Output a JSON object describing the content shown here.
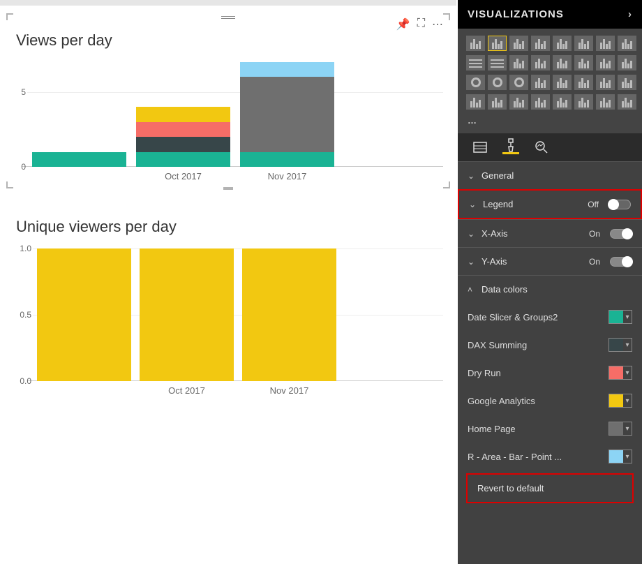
{
  "panel": {
    "title": "VISUALIZATIONS",
    "tabs_selected": "format",
    "more_icons": "…",
    "sections": {
      "general": {
        "label": "General",
        "expanded": false
      },
      "legend": {
        "label": "Legend",
        "state_label": "Off",
        "on": false,
        "expanded": false
      },
      "xaxis": {
        "label": "X-Axis",
        "state_label": "On",
        "on": true,
        "expanded": false
      },
      "yaxis": {
        "label": "Y-Axis",
        "state_label": "On",
        "on": true,
        "expanded": false
      },
      "datacolors": {
        "label": "Data colors",
        "expanded": true
      }
    },
    "data_colors": [
      {
        "name": "Date Slicer & Groups2",
        "color": "#1ab394"
      },
      {
        "name": "DAX Summing",
        "color": "#374649"
      },
      {
        "name": "Dry Run",
        "color": "#f66d67"
      },
      {
        "name": "Google Analytics",
        "color": "#f2c811"
      },
      {
        "name": "Home Page",
        "color": "#6f6f6f"
      },
      {
        "name": "R - Area - Bar - Point ...",
        "color": "#8cd4f5"
      }
    ],
    "revert_label": "Revert to default"
  },
  "chart_data": [
    {
      "type": "bar",
      "stacked": true,
      "title": "Views per day",
      "xlabel": "",
      "ylabel": "",
      "ylim": [
        0,
        7
      ],
      "yticks": [
        0,
        5
      ],
      "categories": [
        "",
        "Oct 2017",
        "Nov 2017",
        ""
      ],
      "series": [
        {
          "name": "Date Slicer & Groups2",
          "color": "#1ab394",
          "values": [
            1,
            1,
            1,
            0
          ]
        },
        {
          "name": "DAX Summing",
          "color": "#374649",
          "values": [
            0,
            1,
            0,
            0
          ]
        },
        {
          "name": "Dry Run",
          "color": "#f66d67",
          "values": [
            0,
            1,
            0,
            0
          ]
        },
        {
          "name": "Google Analytics",
          "color": "#f2c811",
          "values": [
            0,
            1,
            0,
            0
          ]
        },
        {
          "name": "Home Page",
          "color": "#6f6f6f",
          "values": [
            0,
            0,
            5,
            0
          ]
        },
        {
          "name": "R - Area - Bar - Point",
          "color": "#8cd4f5",
          "values": [
            0,
            0,
            1,
            0
          ]
        }
      ],
      "present": [
        true,
        true,
        true,
        false
      ]
    },
    {
      "type": "bar",
      "title": "Unique viewers per day",
      "xlabel": "",
      "ylabel": "",
      "ylim": [
        0,
        1
      ],
      "yticks": [
        0.0,
        0.5,
        1.0
      ],
      "categories": [
        "",
        "Oct 2017",
        "Nov 2017",
        ""
      ],
      "series": [
        {
          "name": "Google Analytics",
          "color": "#f2c811",
          "values": [
            1,
            1,
            1,
            0
          ]
        }
      ],
      "present": [
        true,
        true,
        true,
        false
      ]
    }
  ]
}
